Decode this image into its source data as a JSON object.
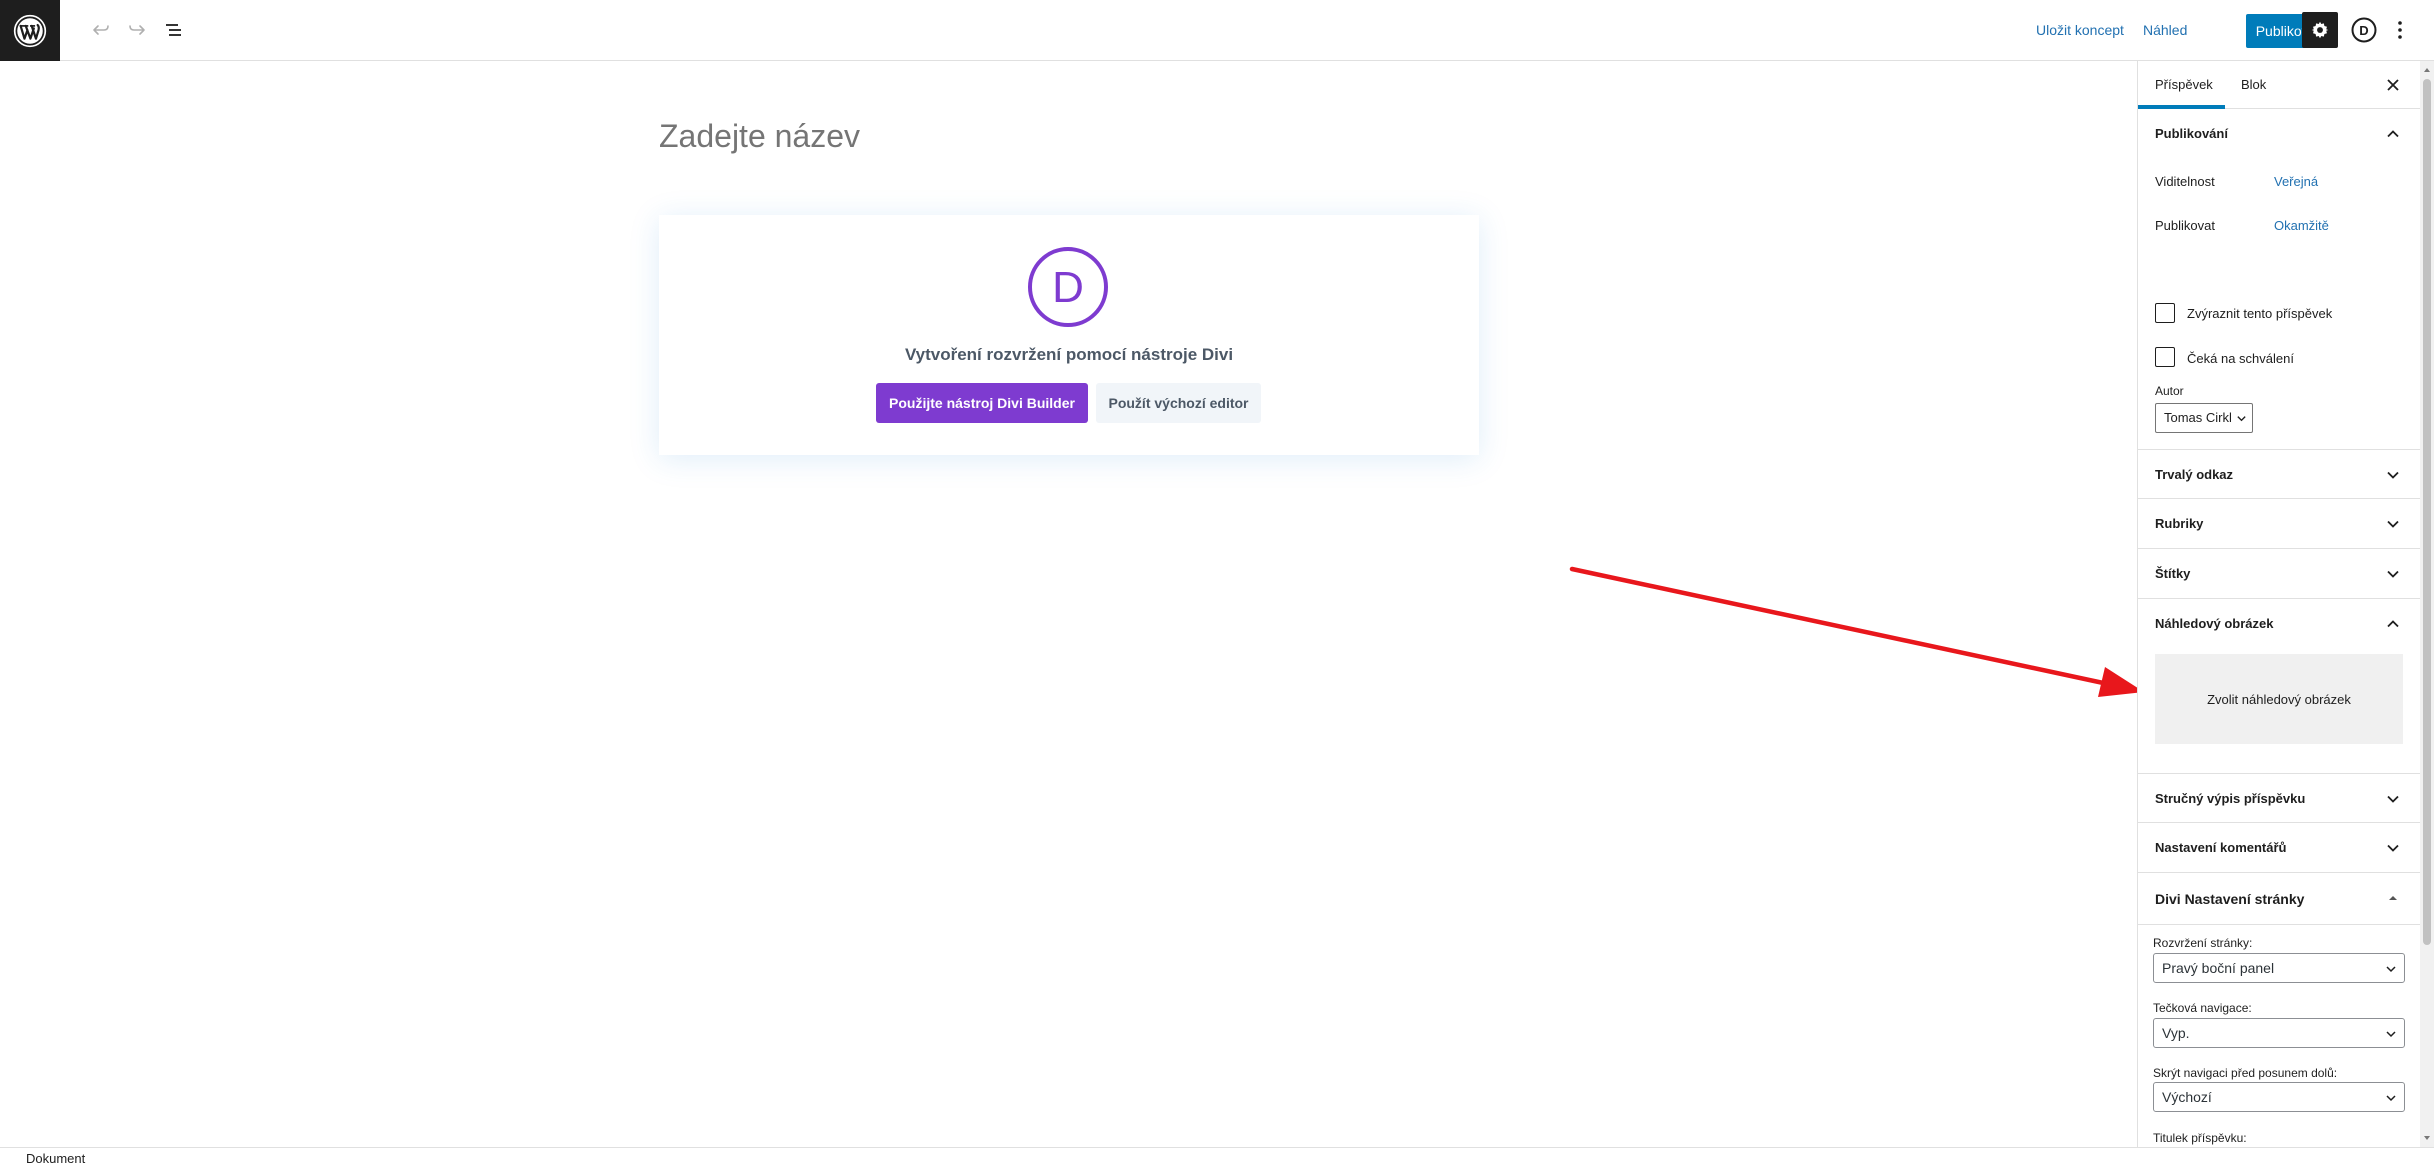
{
  "topbar": {
    "save_draft": "Uložit koncept",
    "preview": "Náhled",
    "publish": "Publikovat",
    "divi_letter": "D",
    "icons": {
      "logo": "wordpress-icon",
      "undo": "undo-icon",
      "redo": "redo-icon",
      "outline": "list-view-icon",
      "settings": "gear-icon",
      "divi": "divi-icon",
      "more": "more-vertical-icon"
    }
  },
  "editor": {
    "title_placeholder": "Zadejte název",
    "divi_card": {
      "logo_letter": "D",
      "title": "Vytvoření rozvržení pomocí nástroje Divi",
      "use_divi": "Použijte nástroj Divi Builder",
      "use_default": "Použít výchozí editor"
    }
  },
  "sidebar": {
    "tabs": [
      {
        "label": "Příspěvek",
        "active": true
      },
      {
        "label": "Blok",
        "active": false
      }
    ],
    "publish_panel": {
      "title": "Publikování",
      "visibility_label": "Viditelnost",
      "visibility_value": "Veřejná",
      "publish_label": "Publikovat",
      "publish_value": "Okamžitě",
      "sticky_label": "Zvýraznit tento příspěvek",
      "pending_label": "Čeká na schválení",
      "author_label": "Autor",
      "author_value": "Tomas Cirkl"
    },
    "panels": {
      "permalink": "Trvalý odkaz",
      "categories": "Rubriky",
      "tags": "Štítky",
      "featured": "Náhledový obrázek",
      "excerpt": "Stručný výpis příspěvku",
      "discussion": "Nastavení komentářů",
      "divi_settings": "Divi Nastavení stránky"
    },
    "featured_button": "Zvolit náhledový obrázek",
    "divi": {
      "layout_label": "Rozvržení stránky:",
      "layout_value": "Pravý boční panel",
      "dot_nav_label": "Tečková navigace:",
      "dot_nav_value": "Vyp.",
      "hide_nav_label": "Skrýt navigaci před posunem dolů:",
      "hide_nav_value": "Výchozí",
      "post_title_label": "Titulek příspěvku:"
    }
  },
  "footer": {
    "label": "Dokument"
  },
  "colors": {
    "accent": "#007cba",
    "divi_purple": "#7e3bd0",
    "link": "#2271b1",
    "arrow": "#e8171c"
  }
}
